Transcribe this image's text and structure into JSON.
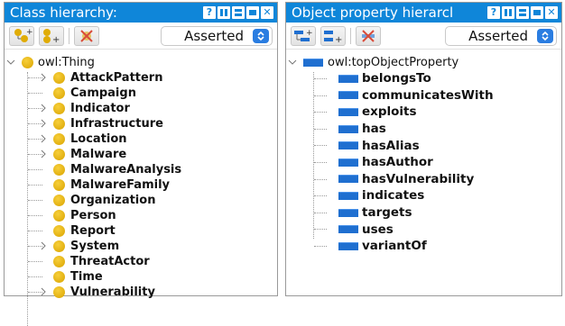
{
  "left_panel": {
    "title": "Class hierarchy:",
    "dropdown_value": "Asserted",
    "root": {
      "label": "owl:Thing",
      "expanded": true
    },
    "items": [
      {
        "label": "AttackPattern",
        "expandable": true
      },
      {
        "label": "Campaign",
        "expandable": false
      },
      {
        "label": "Indicator",
        "expandable": true
      },
      {
        "label": "Infrastructure",
        "expandable": true
      },
      {
        "label": "Location",
        "expandable": true
      },
      {
        "label": "Malware",
        "expandable": true
      },
      {
        "label": "MalwareAnalysis",
        "expandable": false
      },
      {
        "label": "MalwareFamily",
        "expandable": false
      },
      {
        "label": "Organization",
        "expandable": false
      },
      {
        "label": "Person",
        "expandable": false
      },
      {
        "label": "Report",
        "expandable": false
      },
      {
        "label": "System",
        "expandable": true
      },
      {
        "label": "ThreatActor",
        "expandable": false
      },
      {
        "label": "Time",
        "expandable": false
      },
      {
        "label": "Vulnerability",
        "expandable": true
      }
    ]
  },
  "right_panel": {
    "title": "Object property hierarcl",
    "dropdown_value": "Asserted",
    "root": {
      "label": "owl:topObjectProperty",
      "expanded": true
    },
    "items": [
      {
        "label": "belongsTo"
      },
      {
        "label": "communicatesWith"
      },
      {
        "label": "exploits"
      },
      {
        "label": "has"
      },
      {
        "label": "hasAlias"
      },
      {
        "label": "hasAuthor"
      },
      {
        "label": "hasVulnerability"
      },
      {
        "label": "indicates"
      },
      {
        "label": "targets"
      },
      {
        "label": "uses"
      },
      {
        "label": "variantOf"
      }
    ]
  },
  "window_buttons": [
    "help",
    "split-vertical",
    "split-horizontal",
    "maximize",
    "close"
  ],
  "colors": {
    "titlebar": "#0f86d9",
    "class_icon": "#e0ac06",
    "property_icon": "#1f6fd0",
    "dropdown_arrow": "#2a7de1"
  }
}
